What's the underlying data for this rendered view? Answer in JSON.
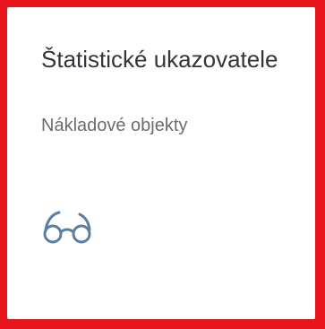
{
  "tile": {
    "title": "Štatistické ukazovatele",
    "subtitle": "Nákladové objekty",
    "icon": "glasses-icon"
  },
  "colors": {
    "highlight_border": "#e8141b",
    "title_text": "#32363a",
    "subtitle_text": "#6a6d70",
    "icon": "#5b7fa3"
  }
}
